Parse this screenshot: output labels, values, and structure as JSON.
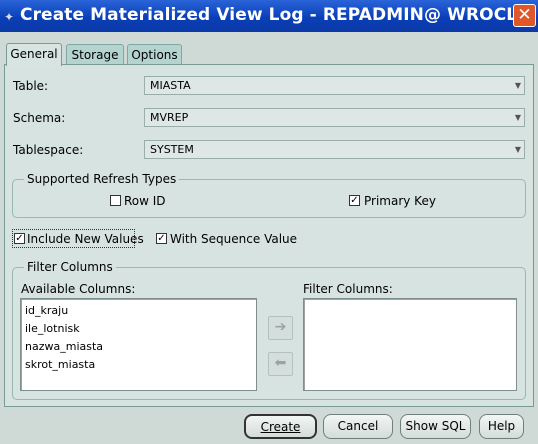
{
  "window": {
    "title": "Create Materialized View Log - REPADMIN@ WROCLA...",
    "close_glyph": "✕",
    "app_icon": "oracle-app-icon"
  },
  "tabs": [
    {
      "label": "General",
      "active": true
    },
    {
      "label": "Storage",
      "active": false
    },
    {
      "label": "Options",
      "active": false
    }
  ],
  "general": {
    "table_label": "Table:",
    "table_value": "MIASTA",
    "schema_label": "Schema:",
    "schema_value": "MVREP",
    "tablespace_label": "Tablespace:",
    "tablespace_value": "SYSTEM"
  },
  "refresh_types": {
    "legend": "Supported Refresh Types",
    "row_id": {
      "label": "Row ID",
      "checked": false
    },
    "primary_key": {
      "label": "Primary Key",
      "checked": true
    }
  },
  "options": {
    "include_new_values": {
      "label": "Include New Values",
      "checked": true
    },
    "with_sequence_value": {
      "label": "With Sequence Value",
      "checked": true
    }
  },
  "filter_columns": {
    "legend": "Filter Columns",
    "available_label": "Available Columns:",
    "filter_label": "Filter Columns:",
    "available": [
      "id_kraju",
      "ile_lotnisk",
      "nazwa_miasta",
      "skrot_miasta"
    ],
    "selected": [],
    "move_right_glyph": "➔",
    "move_left_glyph": "⬅"
  },
  "buttons": {
    "create": "Create",
    "cancel": "Cancel",
    "show_sql": "Show SQL",
    "help": "Help"
  },
  "colors": {
    "titlebar": "#0a3fb8",
    "close": "#e0582a",
    "panel": "#d7e3e1",
    "tab": "#b4d4d0"
  }
}
